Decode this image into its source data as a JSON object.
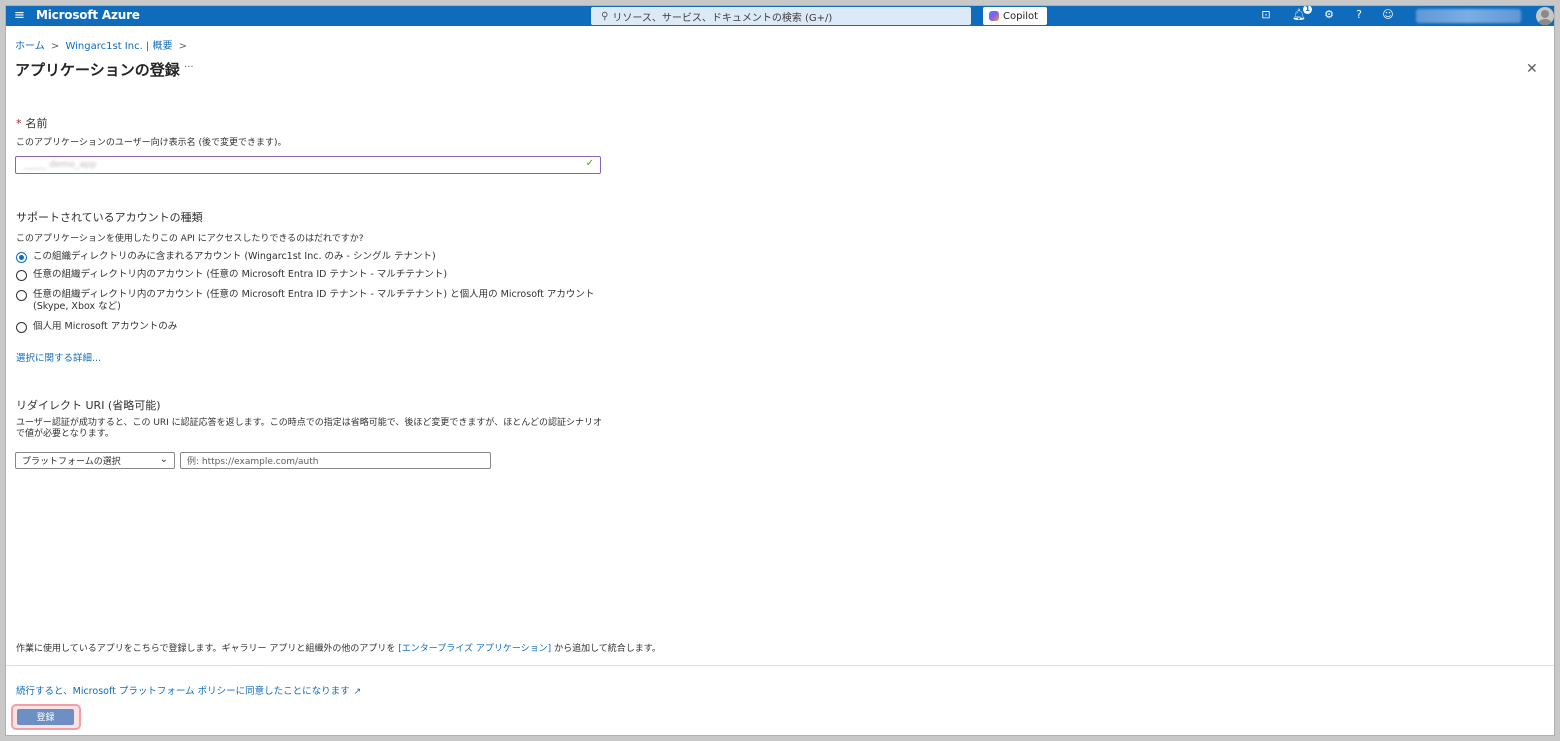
{
  "topbar": {
    "brand": "Microsoft Azure",
    "search_placeholder": "リソース、サービス、ドキュメントの検索 (G+/)",
    "copilot_label": "Copilot",
    "notification_count": "1",
    "icons": [
      "menu-icon",
      "search-icon",
      "cloud-shell-icon",
      "notifications-icon",
      "settings-icon",
      "help-icon",
      "feedback-icon",
      "avatar"
    ]
  },
  "breadcrumb": {
    "items": [
      "ホーム",
      "Wingarc1st Inc. | 概要"
    ],
    "separator": ">"
  },
  "page": {
    "title": "アプリケーションの登録",
    "more": "···",
    "close": "✕"
  },
  "name_section": {
    "required_mark": "*",
    "label": "名前",
    "description": "このアプリケーションのユーザー向け表示名 (後で変更できます)。",
    "value": "_____ demo_app"
  },
  "account_section": {
    "heading": "サポートされているアカウントの種類",
    "question": "このアプリケーションを使用したりこの API にアクセスしたりできるのはだれですか?",
    "options": [
      {
        "label": "この組織ディレクトリのみに含まれるアカウント (Wingarc1st Inc. のみ - シングル テナント)",
        "checked": true
      },
      {
        "label": "任意の組織ディレクトリ内のアカウント (任意の Microsoft Entra ID テナント - マルチテナント)",
        "checked": false
      },
      {
        "label": "任意の組織ディレクトリ内のアカウント (任意の Microsoft Entra ID テナント - マルチテナント) と個人用の Microsoft アカウント (Skype, Xbox など)",
        "checked": false
      },
      {
        "label": "個人用 Microsoft アカウントのみ",
        "checked": false
      }
    ],
    "details_link": "選択に関する詳細..."
  },
  "redirect_section": {
    "heading": "リダイレクト URI (省略可能)",
    "description": "ユーザー認証が成功すると、この URI に認証応答を返します。この時点での指定は省略可能で、後ほど変更できますが、ほとんどの認証シナリオで値が必要となります。",
    "platform_select": "プラットフォームの選択",
    "uri_placeholder": "例: https://example.com/auth"
  },
  "footer": {
    "note_before": "作業に使用しているアプリをこちらで登録します。ギャラリー アプリと組織外の他のアプリを ",
    "note_link": "[エンタープライズ アプリケーション]",
    "note_after": " から追加して統合します。",
    "policy_link": "続行すると、Microsoft プラットフォーム ポリシーに同意したことになります",
    "register_button": "登録"
  },
  "colors": {
    "azure_blue": "#0f6cbd",
    "input_focus": "#8764b8",
    "highlight": "#f0a0a6"
  }
}
